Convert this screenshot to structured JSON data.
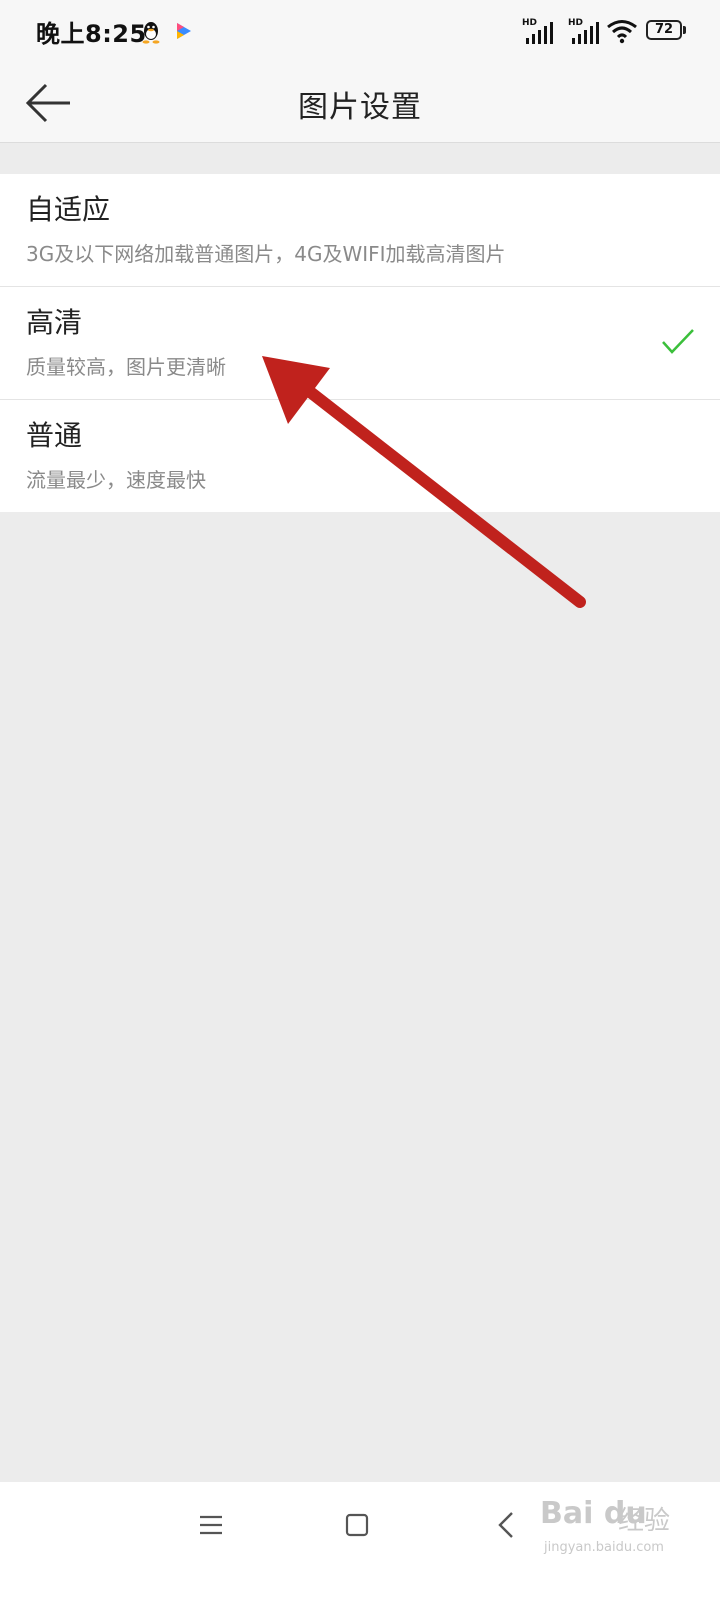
{
  "status_bar": {
    "time": "晚上8:25",
    "battery": "72",
    "signal_label": "HD",
    "icons": [
      "qq-icon",
      "video-app-icon",
      "hd-signal-icon",
      "hd-signal-icon",
      "wifi-icon",
      "battery-icon"
    ]
  },
  "header": {
    "title": "图片设置",
    "back_icon": "back-arrow-icon"
  },
  "options": [
    {
      "title": "自适应",
      "desc": "3G及以下网络加载普通图片，4G及WIFI加载高清图片",
      "selected": false
    },
    {
      "title": "高清",
      "desc": "质量较高，图片更清晰",
      "selected": true
    },
    {
      "title": "普通",
      "desc": "流量最少，速度最快",
      "selected": false
    }
  ],
  "colors": {
    "check": "#3bbf3b",
    "annotation_arrow": "#c0221d",
    "background": "#ececec"
  },
  "nav_bar": {
    "icons": [
      "menu-icon",
      "home-icon",
      "back-icon"
    ]
  },
  "watermark": {
    "logo": "Bai du",
    "text": "经验",
    "url": "jingyan.baidu.com"
  }
}
